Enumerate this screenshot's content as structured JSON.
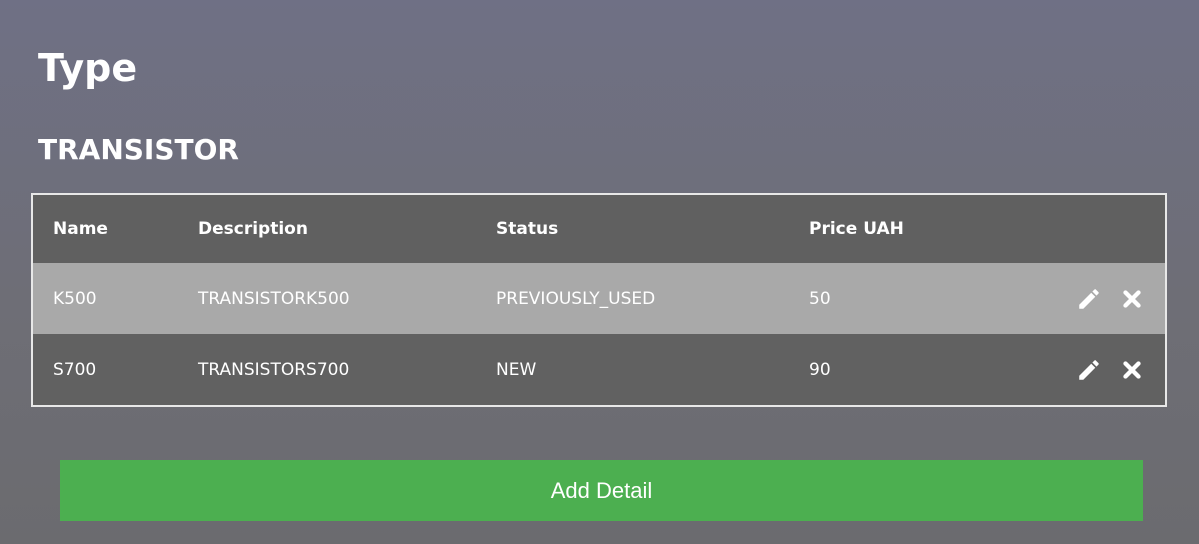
{
  "page": {
    "title": "Type",
    "type_name": "TRANSISTOR"
  },
  "table": {
    "headers": {
      "name": "Name",
      "description": "Description",
      "status": "Status",
      "price": "Price UAH"
    },
    "rows": [
      {
        "name": "K500",
        "description": "TRANSISTORK500",
        "status": "PREVIOUSLY_USED",
        "price": "50"
      },
      {
        "name": "S700",
        "description": "TRANSISTORS700",
        "status": "NEW",
        "price": "90"
      }
    ],
    "row_actions": [
      "pencil-icon",
      "close-icon"
    ]
  },
  "actions": {
    "add_label": "Add Detail"
  },
  "colors": {
    "background": "#6f7085",
    "header_row": "#606060",
    "row_light": "#a9a9a9",
    "row_dark": "#616161",
    "table_border": "#e8e8e8",
    "accent_green": "#4caf50",
    "text": "#ffffff"
  }
}
